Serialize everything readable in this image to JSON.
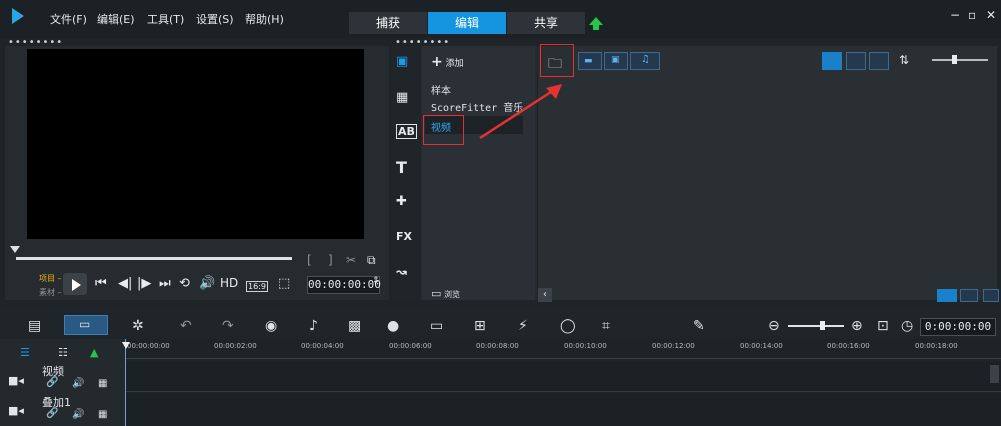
{
  "app": {
    "menu": [
      "文件(F)",
      "编辑(E)",
      "工具(T)",
      "设置(S)",
      "帮助(H)"
    ],
    "tabs": [
      "捕获",
      "编辑",
      "共享"
    ],
    "active_tab": "编辑",
    "window_controls": [
      "−",
      "▫",
      "✕"
    ]
  },
  "player": {
    "labels": {
      "project": "项目 –",
      "material": "素材 –"
    },
    "hd": "HD",
    "aspect": "16:9",
    "timecode": "00:00:00:00"
  },
  "library": {
    "add_label": "添加",
    "items": [
      "样本",
      "ScoreFitter 音乐",
      "视频"
    ],
    "browse_label": "浏览",
    "icons": [
      "media-icon",
      "instant-project-icon",
      "title-icon",
      "text-icon",
      "graphic-icon",
      "fx-icon",
      "transition-icon"
    ]
  },
  "timeline": {
    "timecode": "0:00:00:00",
    "ticks": [
      "00:00:00:00",
      "00:00:02:00",
      "00:00:04:00",
      "00:00:06:00",
      "00:00:08:00",
      "00:00:10:00",
      "00:00:12:00",
      "00:00:14:00",
      "00:00:16:00",
      "00:00:18:00"
    ],
    "tracks": [
      {
        "label": "视频"
      },
      {
        "label": "叠加1"
      }
    ]
  }
}
